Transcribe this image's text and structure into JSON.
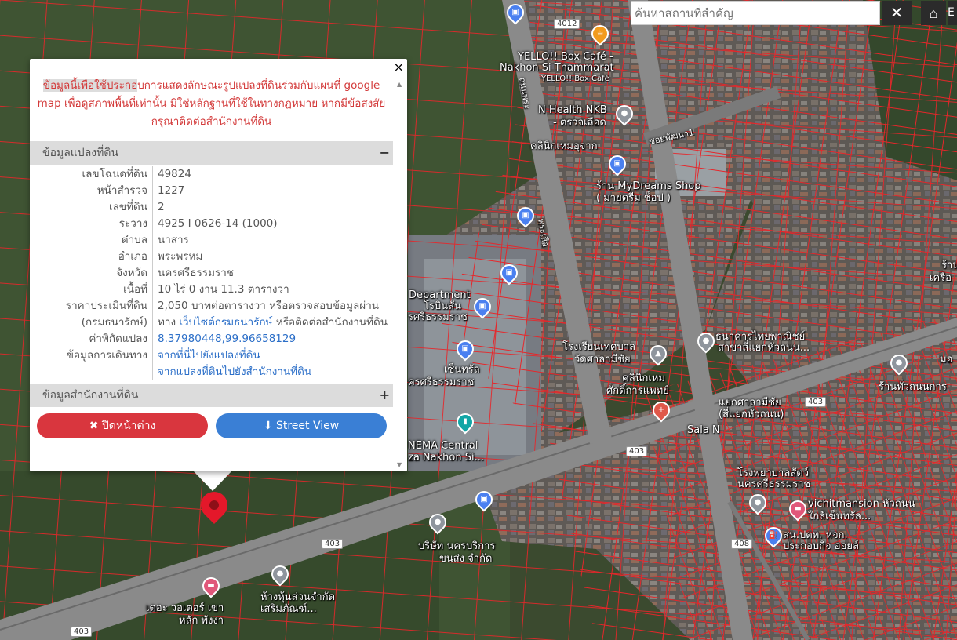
{
  "search": {
    "placeholder": "ค้นหาสถานที่สำคัญ",
    "clear_label": "✕",
    "home_label": "⌂",
    "extra_label": "E"
  },
  "popup": {
    "close_label": "×",
    "disclaimer_highlight": "ข้อมูลนี้เพื่อใช้ประกอ",
    "disclaimer_rest": "บการแสดงลักษณะรูปแปลงที่ดินร่วมกับแผนที่ google map เพื่อดูสภาพพื้นที่เท่านั้น มิใช่หลักฐานที่ใช้ในทางกฎหมาย หากมีข้อสงสัย กรุณาติดต่อสำนักงานที่ดิน",
    "section_land": {
      "title": "ข้อมูลแปลงที่ดิน",
      "toggle": "−"
    },
    "rows": [
      {
        "key": "เลขโฉนดที่ดิน",
        "value": "49824"
      },
      {
        "key": "หน้าสำรวจ",
        "value": "1227"
      },
      {
        "key": "เลขที่ดิน",
        "value": "2"
      },
      {
        "key": "ระวาง",
        "value": "4925 I 0626-14 (1000)"
      },
      {
        "key": "ตำบล",
        "value": "นาสาร"
      },
      {
        "key": "อำเภอ",
        "value": "พระพรหม"
      },
      {
        "key": "จังหวัด",
        "value": "นครศรีธรรมราช"
      },
      {
        "key": "เนื้อที่",
        "value": "10 ไร่ 0 งาน 11.3 ตารางวา"
      }
    ],
    "price_key": "ราคาประเมินที่ดิน",
    "price_key2": "(กรมธนารักษ์)",
    "price_value_1": "2,050 บาทต่อตารางวา หรือตรวจสอบข้อมูลผ่าน",
    "price_value_2a": "ทาง ",
    "price_value_link": "เว็บไซต์กรมธนารักษ์",
    "price_value_2b": " หรือติดต่อสำนักงานที่ดิน",
    "coord_key": "ค่าพิกัดแปลง",
    "coord_value": "8.37980448,99.96658129",
    "travel_key": "ข้อมูลการเดินทาง",
    "travel_link1": "จากที่นี่ไปยังแปลงที่ดิน",
    "travel_link2": "จากแปลงที่ดินไปยังสำนักงานที่ดิน",
    "section_office": {
      "title": "ข้อมูลสำนักงานที่ดิน",
      "toggle": "+"
    },
    "btn_close": "✖ ปิดหน้าต่าง",
    "btn_street": "⬇ Street View"
  },
  "map": {
    "labels": [
      {
        "id": "yello",
        "text": "YELLO!! Box Café -"
      },
      {
        "id": "yello2",
        "text": "Nakhon Si Thammarat"
      },
      {
        "id": "yello3",
        "text": "YELLO!! Box Café"
      },
      {
        "id": "nhealth",
        "text": "N Health NKB"
      },
      {
        "id": "nhealth2",
        "text": "- ตรวจเลือด"
      },
      {
        "id": "clinic",
        "text": "คลินิกเหมอุจาก"
      },
      {
        "id": "mydreams",
        "text": "ร้าน MyDreams Shop"
      },
      {
        "id": "mydreams2",
        "text": "( มายดรีม ช็อป )"
      },
      {
        "id": "soi",
        "text": "ซอยพัฒนา1"
      },
      {
        "id": "dept",
        "text": "Department"
      },
      {
        "id": "dept2",
        "text": "โรบินสัน"
      },
      {
        "id": "dept3",
        "text": "รศรีธรรมราช"
      },
      {
        "id": "school",
        "text": "โรงเรียนเทศบาล"
      },
      {
        "id": "school2",
        "text": "วัดศาลามีชัย"
      },
      {
        "id": "central",
        "text": "เซ็นทรัล"
      },
      {
        "id": "central2",
        "text": "ครศรีธรรมราช"
      },
      {
        "id": "clinic2",
        "text": "คลินิกเหม"
      },
      {
        "id": "clinic3",
        "text": "ศักดิ์การแพทย์"
      },
      {
        "id": "bank",
        "text": "ธนาคารไทยพาณิชย์"
      },
      {
        "id": "bank2",
        "text": "สาขาสี่แยกหัวถนน..."
      },
      {
        "id": "junction",
        "text": "แยกศาลามีชัย"
      },
      {
        "id": "junction2",
        "text": "(สี่แยกหัวถนน)"
      },
      {
        "id": "cinema",
        "text": "NEMA Central"
      },
      {
        "id": "cinema2",
        "text": "za Nakhon Si..."
      },
      {
        "id": "sala",
        "text": "Sala N"
      },
      {
        "id": "hospital",
        "text": "โรงพยาบาลสัตว์"
      },
      {
        "id": "hospital2",
        "text": "นครศรีธรรมราช"
      },
      {
        "id": "mansion",
        "text": "vichitmansion หัวถนน"
      },
      {
        "id": "mansion2",
        "text": "ใกล้เซ็นทรัล..."
      },
      {
        "id": "company",
        "text": "บริษัท นครบริการ"
      },
      {
        "id": "company2",
        "text": "ขนส่ง จำกัด"
      },
      {
        "id": "shop",
        "text": "ห้างหุ้นส่วนจำกัด"
      },
      {
        "id": "shop2",
        "text": "เสริมภัณฑ์..."
      },
      {
        "id": "hotel",
        "text": "เดอะ วอเตอร์ เขา"
      },
      {
        "id": "hotel2",
        "text": "หลัก พังงา"
      },
      {
        "id": "ptt",
        "text": "สน.ปตท. หจก."
      },
      {
        "id": "ptt2",
        "text": "ประกอบกิจ ออยล์"
      },
      {
        "id": "shop3",
        "text": "ร้านทั่วถนนการ"
      },
      {
        "id": "r1",
        "text": "ร้าน"
      },
      {
        "id": "r2",
        "text": "เครือ"
      },
      {
        "id": "r3",
        "text": "มอ"
      },
      {
        "id": "road1",
        "text": "ถนนพระ"
      },
      {
        "id": "road2",
        "text": "พระเสือ"
      }
    ],
    "shields": [
      "4012",
      "403",
      "403",
      "403",
      "403",
      "408"
    ]
  }
}
